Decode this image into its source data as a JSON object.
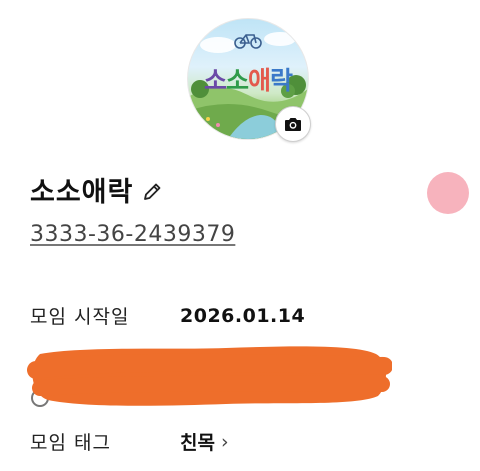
{
  "profile": {
    "logo_text": [
      "소",
      "소",
      "애",
      "락"
    ],
    "camera_icon": "camera-icon",
    "name": "소소애락",
    "edit_icon": "pencil-icon",
    "account_number": "3333-36-2439379"
  },
  "info": {
    "start_label": "모임 시작일",
    "start_value": "2026.01.14",
    "tag_label": "모임 태그",
    "tag_value": "친목",
    "tag_chevron": "›"
  },
  "colors": {
    "accent_dot": "#f7b3bd",
    "redaction": "#ee6e2b"
  }
}
